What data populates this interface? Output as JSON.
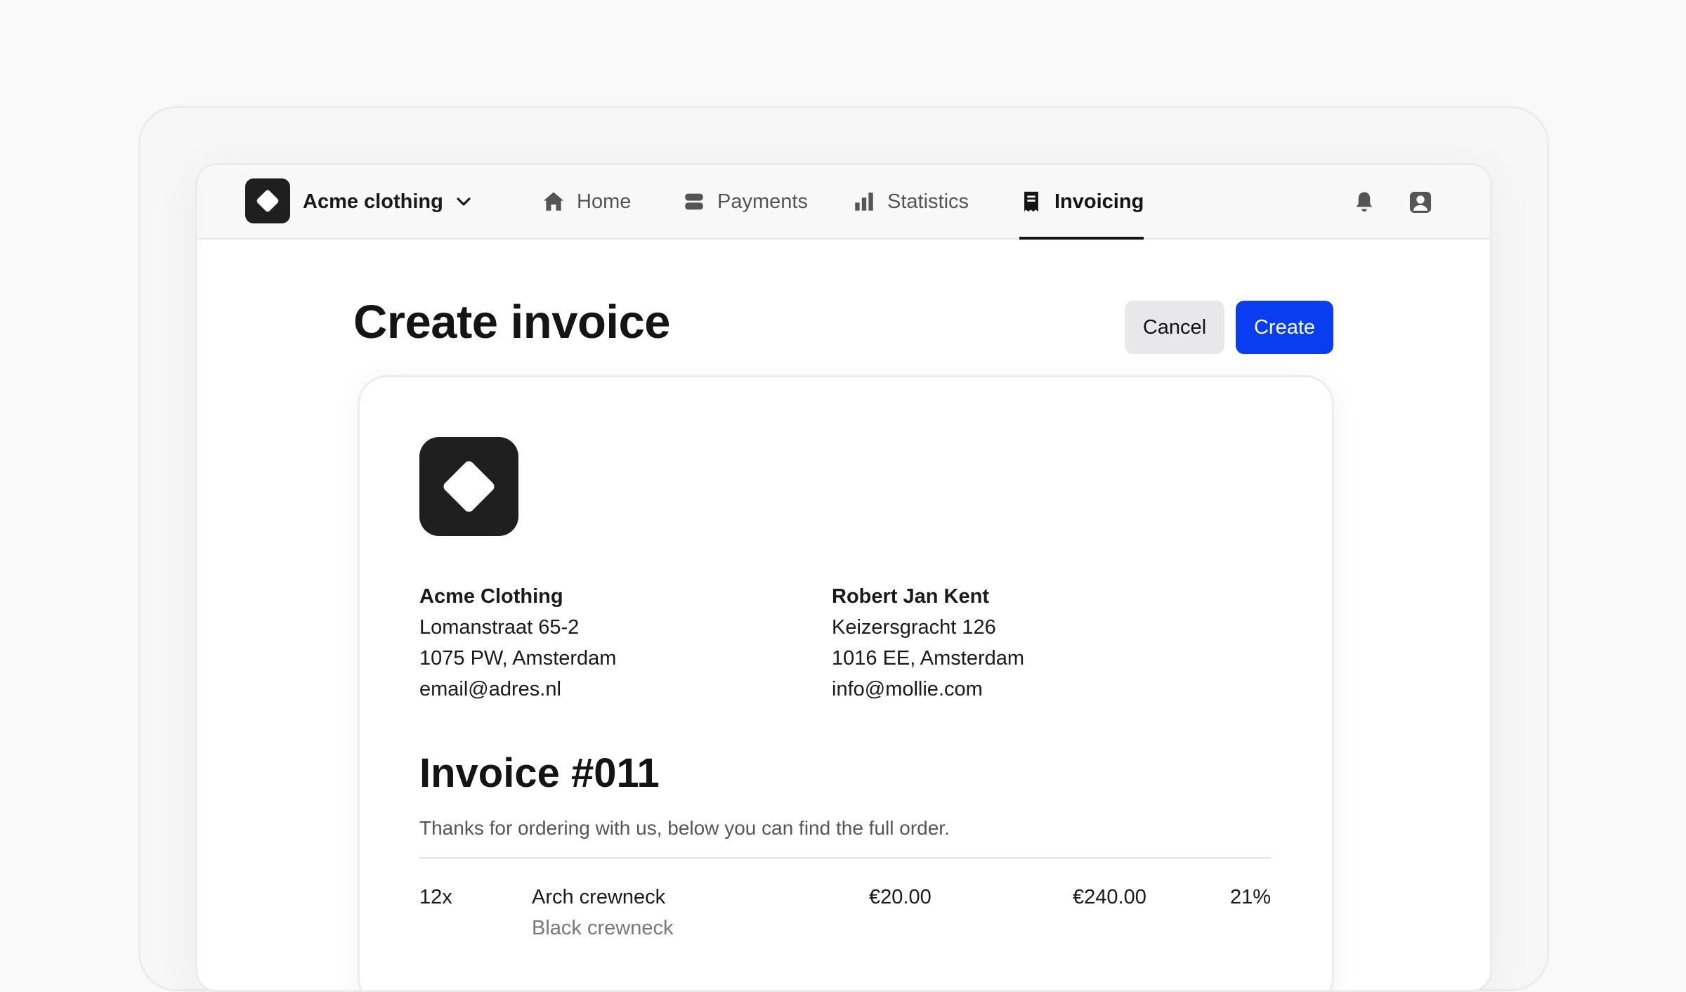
{
  "org": {
    "name": "Acme clothing"
  },
  "nav": {
    "items": [
      {
        "label": "Home",
        "icon": "home-icon"
      },
      {
        "label": "Payments",
        "icon": "payments-icon"
      },
      {
        "label": "Statistics",
        "icon": "statistics-icon"
      },
      {
        "label": "Invoicing",
        "icon": "invoice-icon",
        "active": true
      }
    ]
  },
  "page": {
    "title": "Create invoice",
    "cancel_label": "Cancel",
    "create_label": "Create"
  },
  "invoice": {
    "from": {
      "name": "Acme Clothing",
      "street": "Lomanstraat 65-2",
      "city": "1075 PW, Amsterdam",
      "email": "email@adres.nl"
    },
    "to": {
      "name": "Robert Jan Kent",
      "street": "Keizersgracht 126",
      "city": "1016 EE, Amsterdam",
      "email": "info@mollie.com"
    },
    "title": "Invoice #011",
    "description": "Thanks for ordering with us, below you can find the full order.",
    "lines": [
      {
        "qty": "12x",
        "name": "Arch crewneck",
        "subtitle": "Black crewneck",
        "price": "€20.00",
        "total": "€240.00",
        "vat": "21%"
      }
    ]
  },
  "colors": {
    "primary": "#0a3cf0",
    "logo_bg": "#1f1f1f"
  }
}
